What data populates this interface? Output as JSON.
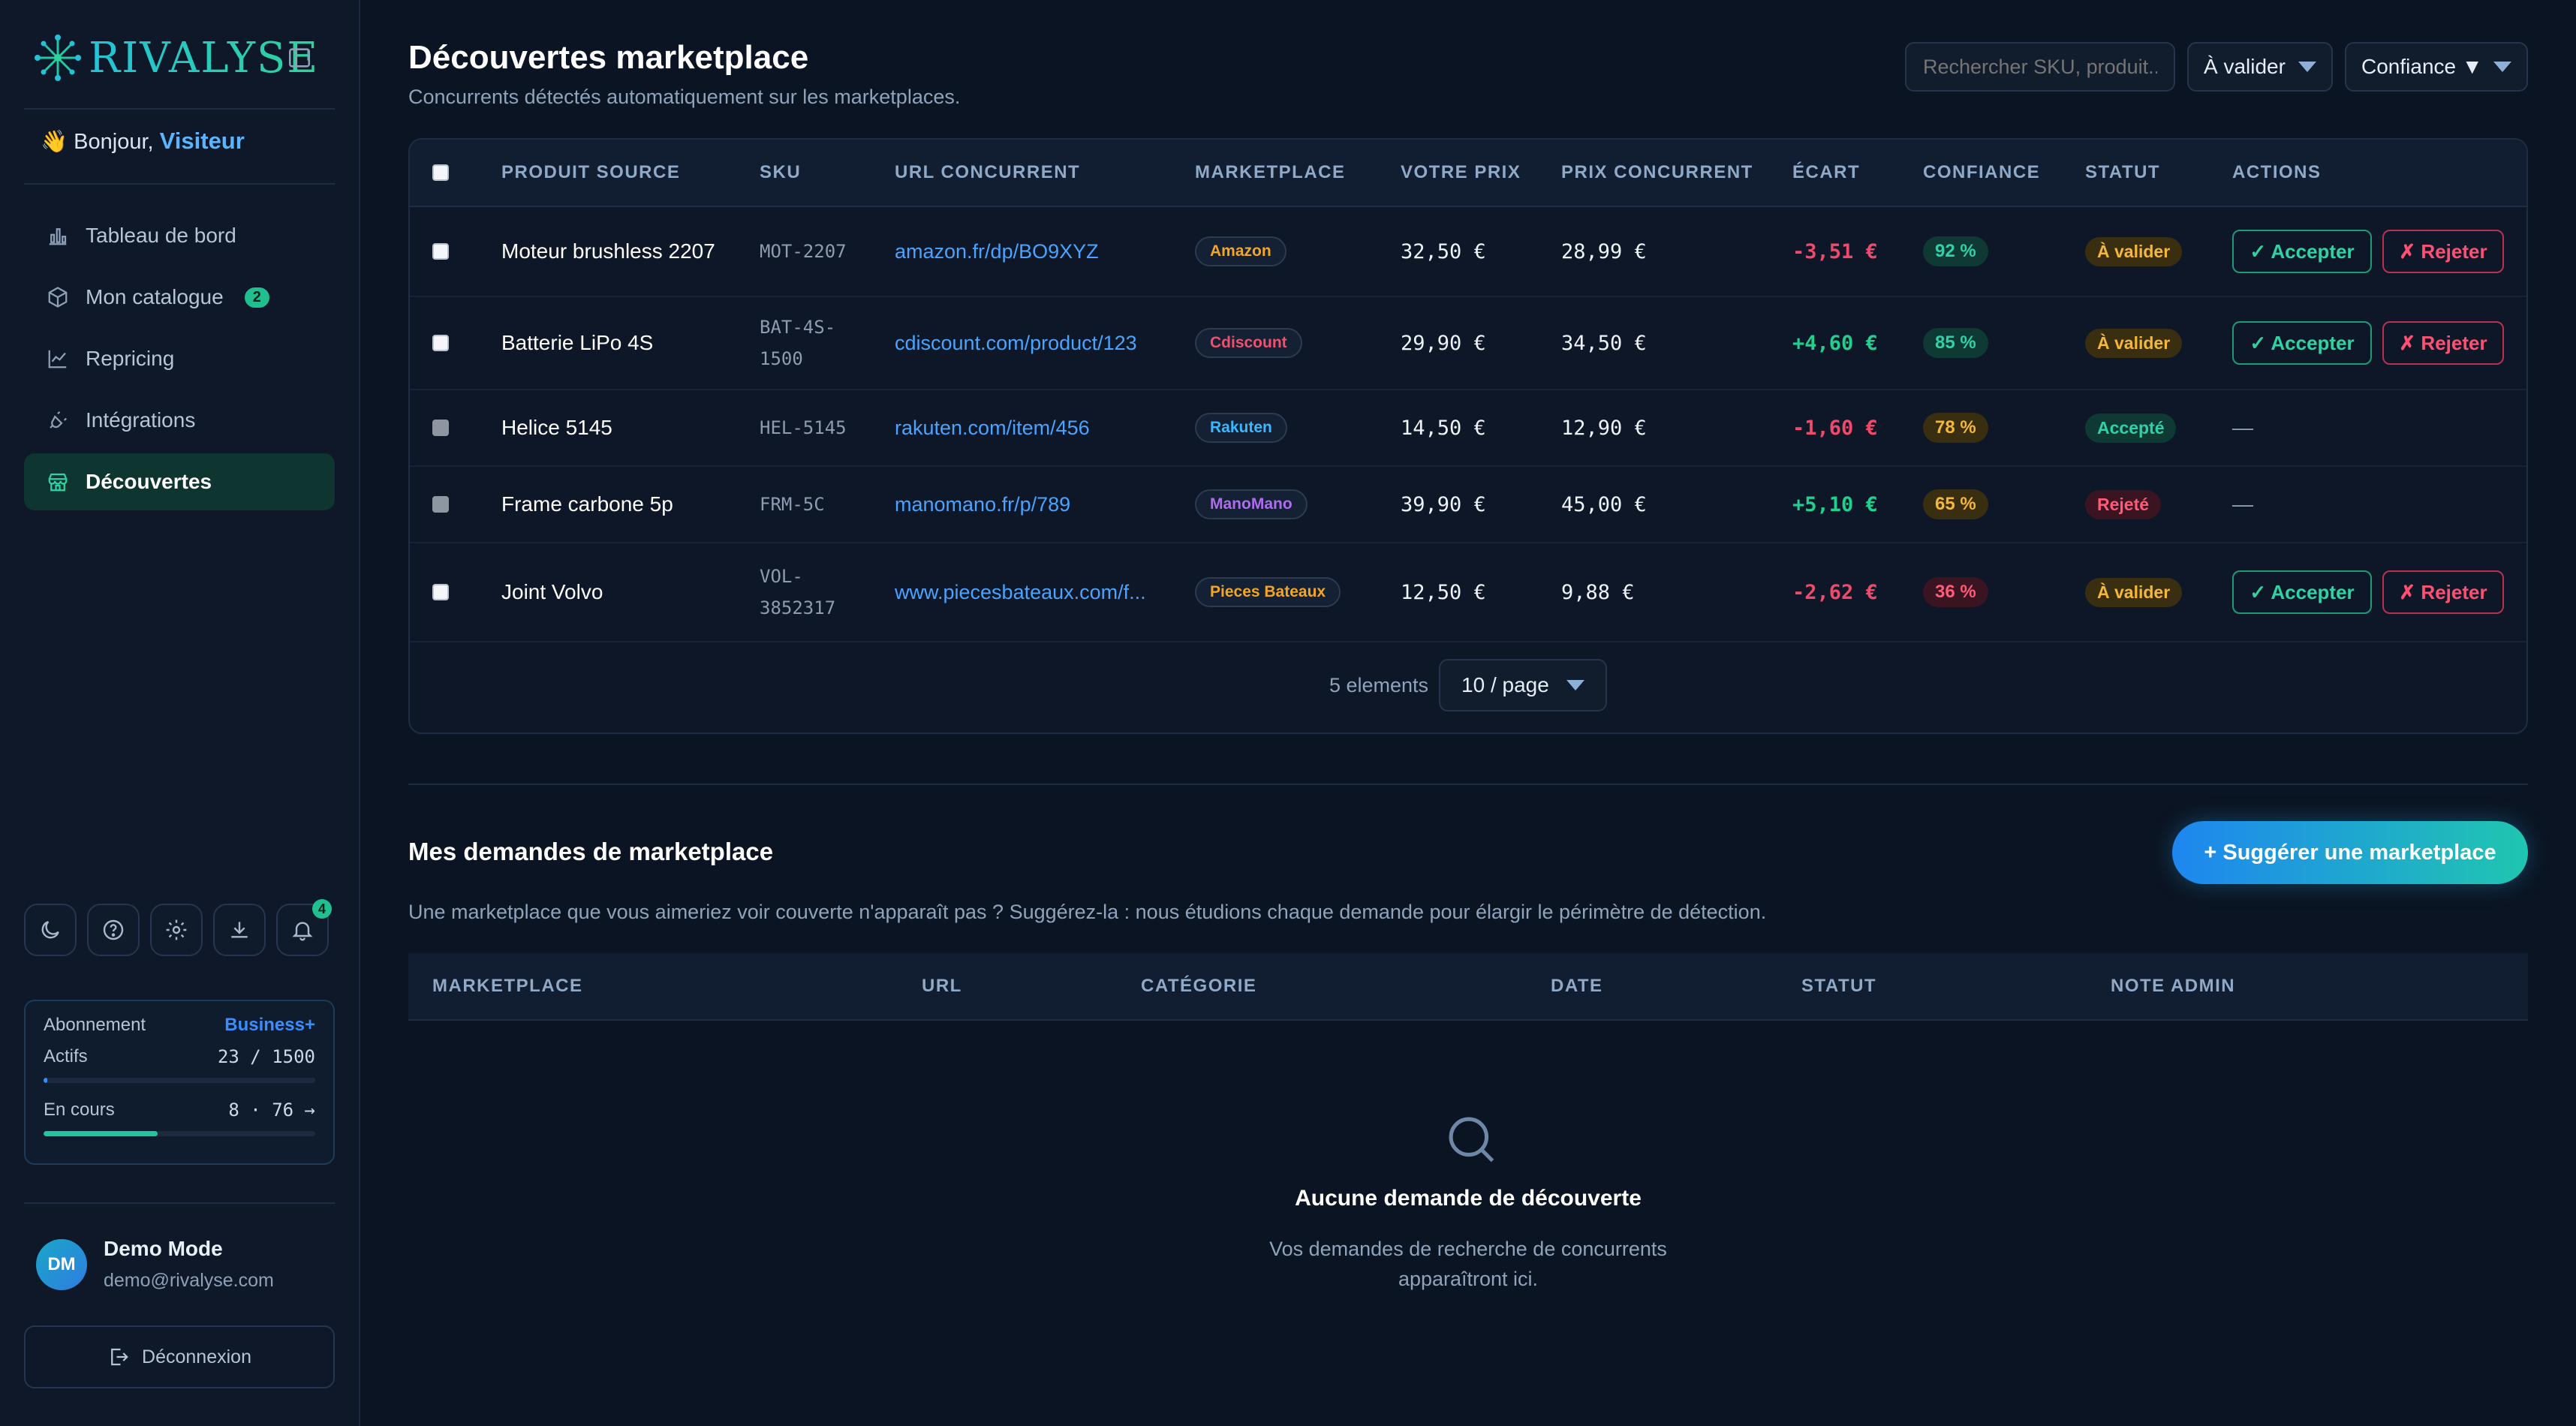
{
  "brand": {
    "name": "RIVALYSE"
  },
  "sidebar": {
    "greeting": "Bonjour,",
    "greeting_emoji": "👋",
    "visitor": "Visiteur",
    "nav": [
      {
        "label": "Tableau de bord",
        "icon": "bar-chart-icon"
      },
      {
        "label": "Mon catalogue",
        "icon": "box-icon",
        "badge": "2"
      },
      {
        "label": "Repricing",
        "icon": "line-chart-icon"
      },
      {
        "label": "Intégrations",
        "icon": "plug-icon"
      },
      {
        "label": "Découvertes",
        "icon": "store-icon",
        "active": true
      }
    ],
    "tools": [
      "moon-icon",
      "help-icon",
      "gear-icon",
      "download-icon",
      "bell-icon"
    ],
    "notifications": "4",
    "subscription": {
      "label": "Abonnement",
      "plan": "Business+",
      "actifs_label": "Actifs",
      "actifs_value": "23 / 1500",
      "actifs_progress": 0.015,
      "encours_label": "En cours",
      "encours_value": "8 · 76 →",
      "encours_progress": 0.42
    },
    "user": {
      "initials": "DM",
      "name": "Demo Mode",
      "email": "demo@rivalyse.com"
    },
    "logout": "Déconnexion"
  },
  "header": {
    "title": "Découvertes marketplace",
    "subtitle": "Concurrents détectés automatiquement sur les marketplaces.",
    "search_placeholder": "Rechercher SKU, produit...",
    "status_filter": "À valider",
    "confidence_filter": "Confiance ▼"
  },
  "table": {
    "columns": [
      "PRODUIT SOURCE",
      "SKU",
      "URL CONCURRENT",
      "MARKETPLACE",
      "VOTRE PRIX",
      "PRIX CONCURRENT",
      "ÉCART",
      "CONFIANCE",
      "STATUT",
      "ACTIONS"
    ],
    "rows": [
      {
        "product": "Moteur brushless 2207",
        "sku": "MOT-2207",
        "url": "amazon.fr/dp/BO9XYZ",
        "marketplace": "Amazon",
        "mp_color": "#f5a524",
        "your_price": "32,50 €",
        "competitor_price": "28,99 €",
        "gap": "-3,51 €",
        "gap_sign": "neg",
        "confidence": "92 %",
        "conf_level": "high",
        "status": "À valider",
        "status_kind": "pending",
        "has_actions": true
      },
      {
        "product": "Batterie LiPo 4S",
        "sku": "BAT-4S-\n1500",
        "url": "cdiscount.com/product/123",
        "marketplace": "Cdiscount",
        "mp_color": "#f0506e",
        "your_price": "29,90 €",
        "competitor_price": "34,50 €",
        "gap": "+4,60 €",
        "gap_sign": "pos",
        "confidence": "85 %",
        "conf_level": "high",
        "status": "À valider",
        "status_kind": "pending",
        "has_actions": true
      },
      {
        "product": "Helice 5145",
        "sku": "HEL-5145",
        "url": "rakuten.com/item/456",
        "marketplace": "Rakuten",
        "mp_color": "#3ab8ff",
        "your_price": "14,50 €",
        "competitor_price": "12,90 €",
        "gap": "-1,60 €",
        "gap_sign": "neg",
        "confidence": "78 %",
        "conf_level": "mid",
        "status": "Accepté",
        "status_kind": "accepted",
        "has_actions": false,
        "empty_action": "—"
      },
      {
        "product": "Frame carbone 5p",
        "sku": "FRM-5C",
        "url": "manomano.fr/p/789",
        "marketplace": "ManoMano",
        "mp_color": "#b06cf0",
        "your_price": "39,90 €",
        "competitor_price": "45,00 €",
        "gap": "+5,10 €",
        "gap_sign": "pos",
        "confidence": "65 %",
        "conf_level": "mid",
        "status": "Rejeté",
        "status_kind": "rejected",
        "has_actions": false,
        "empty_action": "—"
      },
      {
        "product": "Joint Volvo",
        "sku": "VOL-\n3852317",
        "url": "www.piecesbateaux.com/f...",
        "marketplace": "Pieces Bateaux",
        "mp_color": "#f5a524",
        "your_price": "12,50 €",
        "competitor_price": "9,88 €",
        "gap": "-2,62 €",
        "gap_sign": "neg",
        "confidence": "36 %",
        "conf_level": "low",
        "status": "À valider",
        "status_kind": "pending",
        "has_actions": true
      }
    ],
    "accept_label": "✓ Accepter",
    "reject_label": "✗ Rejeter",
    "pager_count": "5 elements",
    "page_size": "10 / page"
  },
  "requests": {
    "title": "Mes demandes de marketplace",
    "suggest_button": "+ Suggérer une marketplace",
    "description": "Une marketplace que vous aimeriez voir couverte n'apparaît pas ? Suggérez-la : nous étudions chaque demande pour élargir le périmètre de détection.",
    "columns": [
      "MARKETPLACE",
      "URL",
      "CATÉGORIE",
      "DATE",
      "STATUT",
      "NOTE ADMIN"
    ],
    "empty_title": "Aucune demande de découverte",
    "empty_text_line1": "Vos demandes de recherche de concurrents",
    "empty_text_line2": "apparaîtront ici."
  },
  "colors": {
    "accent_teal": "#2fd3a3",
    "accent_blue": "#3b8dff",
    "negative": "#ef4a6b",
    "positive": "#1fd08f",
    "background": "#0b1422"
  }
}
